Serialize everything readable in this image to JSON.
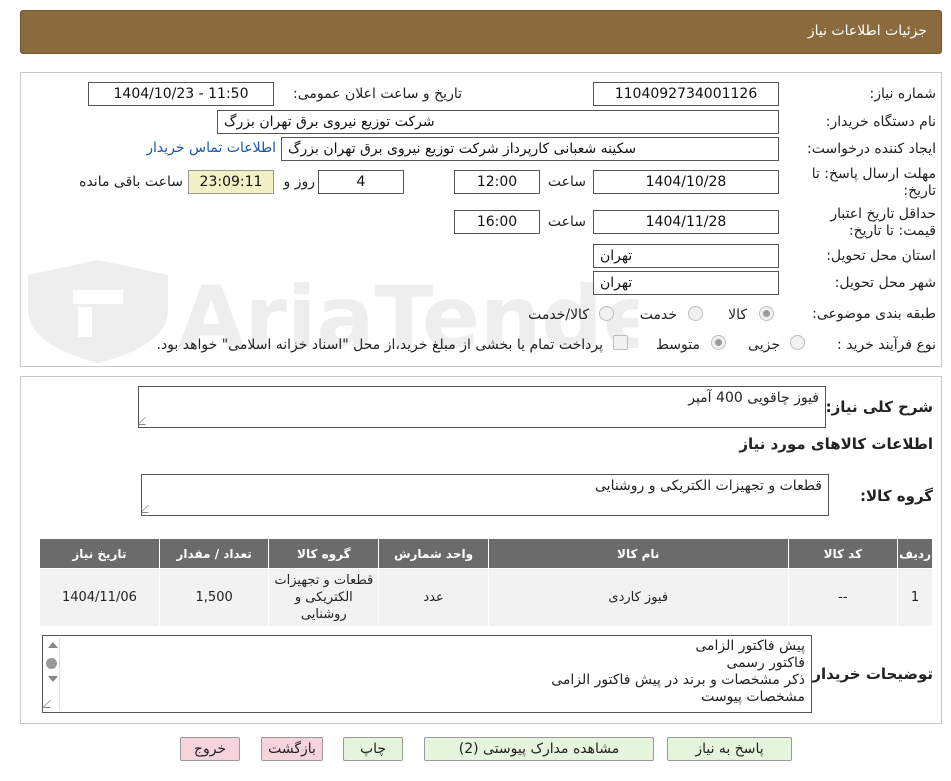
{
  "header": {
    "title": "جزئیات اطلاعات نیاز"
  },
  "watermark": {
    "text": "AriaTender.neT"
  },
  "form": {
    "need_number_label": "شماره نیاز:",
    "need_number": "1104092734001126",
    "announce_label": "تاریخ و ساعت اعلان عمومی:",
    "announce_value": "1404/10/23 - 11:50",
    "buyer_org_label": "نام دستگاه خریدار:",
    "buyer_org": "شرکت توزیع نیروی برق تهران بزرگ",
    "creator_label": "ایجاد کننده درخواست:",
    "creator": "سکینه شعبانی کارپرداز شرکت توزیع نیروی برق تهران بزرگ",
    "contact_link": "اطلاعات تماس خریدار",
    "deadline_label": "مهلت ارسال پاسخ: تا تاریخ:",
    "deadline_date": "1404/10/28",
    "time_label": "ساعت",
    "deadline_time": "12:00",
    "days_value": "4",
    "days_label": "روز و",
    "remaining_time": "23:09:11",
    "remaining_label": "ساعت باقی مانده",
    "validity_label": "حداقل تاریخ اعتبار قیمت: تا تاریخ:",
    "validity_date": "1404/11/28",
    "validity_time": "16:00",
    "province_label": "استان محل تحویل:",
    "province": "تهران",
    "city_label": "شهر محل تحویل:",
    "city": "تهران",
    "category_label": "طبقه بندی موضوعی:",
    "category_options": [
      "کالا",
      "خدمت",
      "کالا/خدمت"
    ],
    "process_label": "نوع فرآیند خرید :",
    "process_options": [
      "جزیی",
      "متوسط"
    ],
    "payment_note": "پرداخت تمام یا بخشی از مبلغ خرید،از محل \"اسناد خزانه اسلامی\" خواهد بود."
  },
  "details": {
    "summary_label": "شرح کلی نیاز:",
    "summary": "فیوز چاقویی 400 آمپر",
    "goods_info_title": "اطلاعات کالاهای مورد نیاز",
    "goods_group_label": "گروه کالا:",
    "goods_group": "قطعات و تجهیزات الکتریکی و روشنایی",
    "table": {
      "headers": [
        "ردیف",
        "کد کالا",
        "نام کالا",
        "واحد شمارش",
        "گروه کالا",
        "تعداد / مقدار",
        "تاریخ نیاز"
      ],
      "rows": [
        [
          "1",
          "--",
          "فیوز کاردی",
          "عدد",
          "قطعات و تجهیزات الکتریکی و روشنایی",
          "1,500",
          "1404/11/06"
        ]
      ]
    },
    "buyer_notes_label": "توضیحات خریدار:",
    "buyer_notes": [
      "پیش فاکتور الزامی",
      "فاکتور رسمی",
      "ذکر مشخصات و برند در پیش فاکتور الزامی",
      "مشخصات پیوست"
    ]
  },
  "buttons": {
    "reply": "پاسخ به نیاز",
    "attachments": "مشاهده مدارک پیوستی (2)",
    "print": "چاپ",
    "back": "بازگشت",
    "exit": "خروج"
  }
}
